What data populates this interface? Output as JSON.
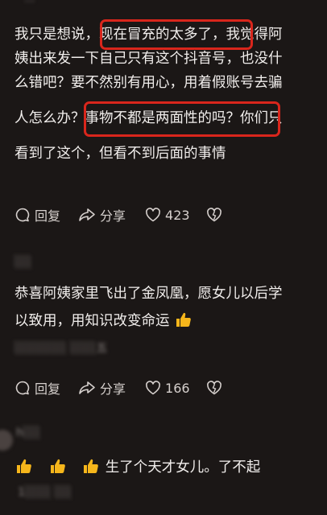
{
  "top_author": "···",
  "comment1": {
    "line1": "我只是想说，现在冒充的太多了，我觉得阿",
    "line2": "姨出来发一下自己只有这个抖音号，也没什",
    "line3": "么错吧？要不然别有用心，用着假账号去骗",
    "line4": "人怎么办？事物不都是两面性的吗？你们只",
    "line5": "看到了这个，但看不到后面的事情",
    "reply": "回复",
    "share": "分享",
    "likes": "423"
  },
  "comment2": {
    "author": "░░",
    "line1": "恭喜阿姨家里飞出了金凤凰，愿女儿以后学",
    "line2": "以致用，用知识改变命运",
    "sub": "░░░░░░ ░░░五",
    "reply": "回复",
    "share": "分享",
    "likes": "166"
  },
  "comment3": {
    "author": "h░░",
    "text": "生了个天才女儿。了不起",
    "sub": "1░░░ ░░"
  },
  "colors": {
    "background": "#1b1716",
    "highlight_box": "#d9261c",
    "emoji": "#f6b61b"
  },
  "icons": [
    "comment-icon",
    "share-icon",
    "heart-icon",
    "dislike-heart-icon",
    "thumbs-up-emoji"
  ]
}
